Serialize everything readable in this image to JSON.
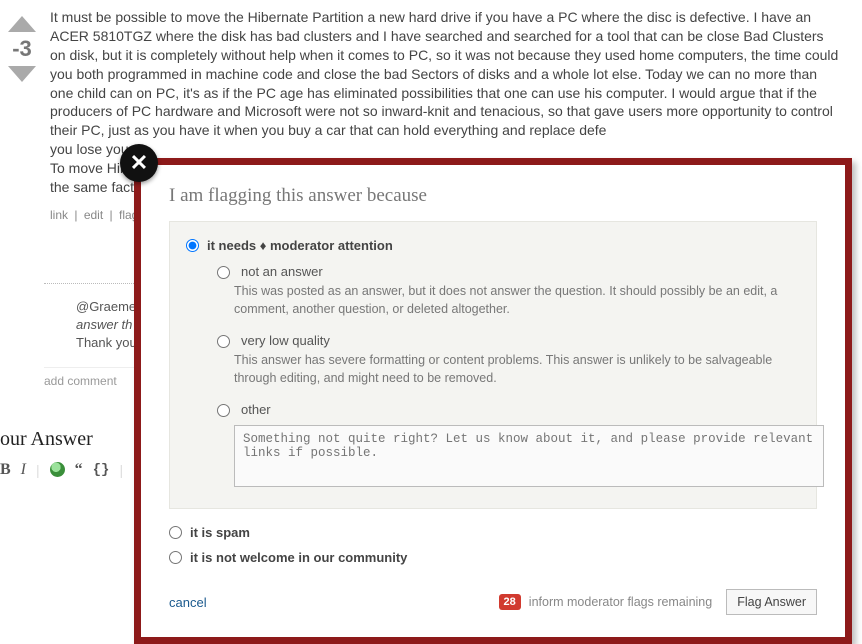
{
  "post": {
    "score": "-3",
    "body": "It must be possible to move the Hibernate Partition a new hard drive if you have a PC where the disc is defective. I have an ACER 5810TGZ where the disk has bad clusters and I have searched and searched for a tool that can be close Bad Clusters on disk, but it is completely without help when it comes to PC, so it was not because they used home computers, the time could you both programmed in machine code and close the bad Sectors of disks and a whole lot else. Today we can no more than one child can on PC, it's as if the PC age has eliminated possibilities that one can use his computer. I would argue that if the producers of PC hardware and Microsoft were not so inward-knit and tenacious, so that gave users more opportunity to control their PC, just as you have it when you buy a car that can hold everything and replace defe\nyou lose your\nTo move Hibe\nthe same fact",
    "menu": {
      "link": "link",
      "edit": "edit",
      "flag": "flag"
    }
  },
  "comment": {
    "line1_prefix": "@Graeme",
    "line2_italic": "answer th",
    "line3": "Thank you"
  },
  "add_comment": "add comment",
  "answer_heading": "our Answer",
  "flag_dialog": {
    "title": "I am flagging this answer because",
    "opt_mod": "it needs ♦ moderator attention",
    "sub_not_answer_label": "not an answer",
    "sub_not_answer_desc": "This was posted as an answer, but it does not answer the question. It should possibly be an edit, a comment, another question, or deleted altogether.",
    "sub_vlq_label": "very low quality",
    "sub_vlq_desc": "This answer has severe formatting or content problems. This answer is unlikely to be salvageable through editing, and might need to be removed.",
    "sub_other_label": "other",
    "sub_other_placeholder": "Something not quite right? Let us know about it, and please provide relevant links if possible.",
    "opt_spam": "it is spam",
    "opt_not_welcome": "it is not welcome in our community",
    "cancel": "cancel",
    "remaining_count": "28",
    "remaining_text": "inform moderator flags remaining",
    "button": "Flag Answer"
  }
}
